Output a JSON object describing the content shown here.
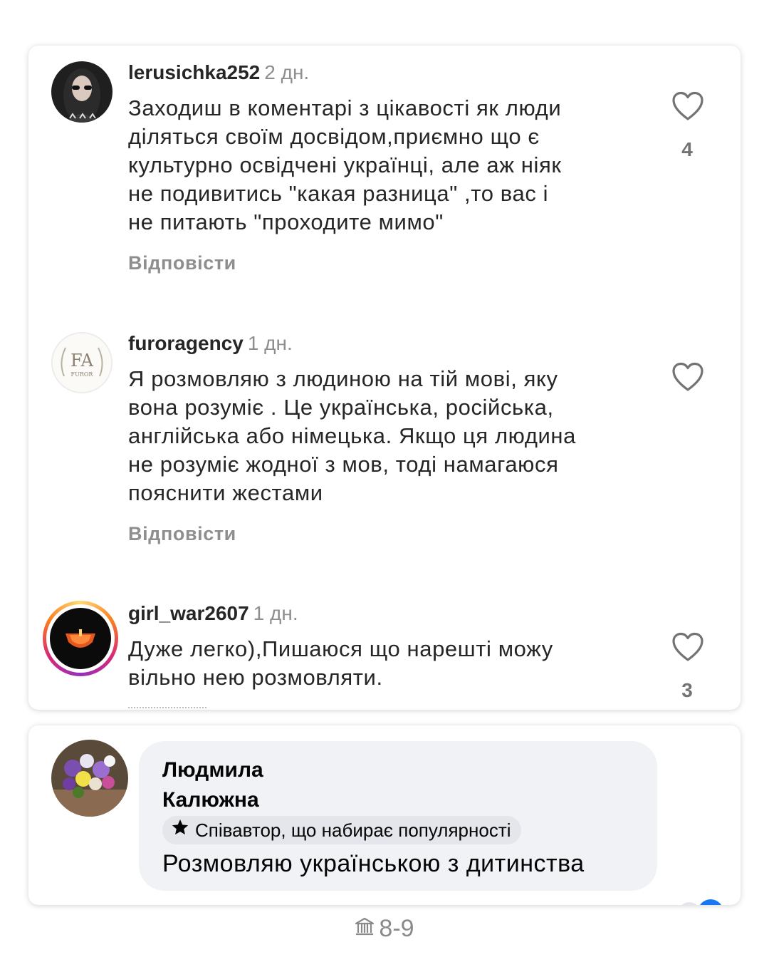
{
  "instagram": {
    "comments": [
      {
        "username": "lerusichka252",
        "time": "2 дн.",
        "text": "Заходиш в коментарі з цікавості як люди\nділяться своїм досвідом,приємно що є\nкультурно освідчені українці, але аж ніяк\nне подивитись \"какая разница\" ,то вас і\nне питають \"проходите мимо\"",
        "likes": "4",
        "reply": "Відповісти"
      },
      {
        "username": "furoragency",
        "time": "1 дн.",
        "text": "Я розмовляю з людиною на тій мові, яку\nвона розуміє . Це українська, російська,\nанглійська або німецька. Якщо ця людина\nне розуміє жодної з мов,  тоді намагаюся\nпояснити жестами",
        "likes": "",
        "reply": "Відповісти",
        "avatar_text": "FA",
        "avatar_subtext": "FUROR"
      },
      {
        "username": "girl_war2607",
        "time": "1 дн.",
        "text": "Дуже легко),Пишаюся що нарешті можу\nвільно нею розмовляти.",
        "likes": "3"
      }
    ]
  },
  "facebook": {
    "name": "Людмила\nКалюжна",
    "badge": "Співавтор, що набирає популярності",
    "text": "Розмовляю українською з дитинства"
  },
  "pager": {
    "label": "8-9",
    "icon": "bank-icon"
  },
  "colors": {
    "text": "#262626",
    "muted": "#8e8e8e",
    "fb_bubble": "#f0f2f5",
    "fb_blue": "#1877f2",
    "story_ring": "#d62976"
  }
}
